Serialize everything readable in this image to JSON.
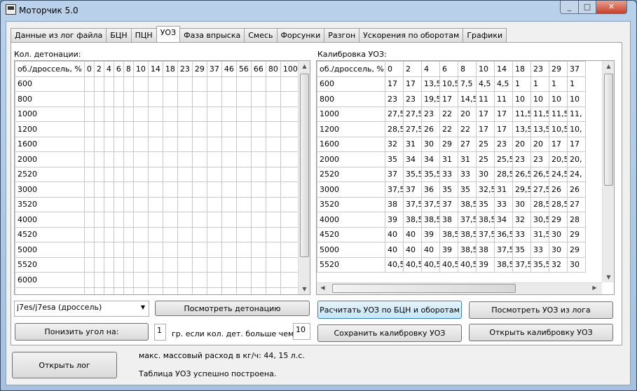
{
  "window": {
    "title": "Моторчик 5.0"
  },
  "tabs": [
    "Данные из лог файла",
    "БЦН",
    "ПЦН",
    "УОЗ",
    "Фаза впрыска",
    "Смесь",
    "Форсунки",
    "Разгон",
    "Ускорения по оборотам",
    "Графики"
  ],
  "active_tab": "УОЗ",
  "left": {
    "label": "Кол. детонации:",
    "corner": "об./дроссель, %",
    "columns": [
      "0",
      "2",
      "4",
      "6",
      "8",
      "10",
      "14",
      "18",
      "23",
      "29",
      "37",
      "46",
      "56",
      "66",
      "80",
      "100"
    ],
    "rows": [
      "600",
      "800",
      "1000",
      "1200",
      "1600",
      "2000",
      "2520",
      "3000",
      "3520",
      "4000",
      "4520",
      "5000",
      "5520",
      "6000"
    ]
  },
  "right": {
    "label": "Калибровка УОЗ:",
    "corner": "об./дроссель, %",
    "columns": [
      "0",
      "2",
      "4",
      "6",
      "8",
      "10",
      "14",
      "18",
      "23",
      "29",
      "37"
    ],
    "rows": [
      {
        "rpm": "600",
        "v": [
          "17",
          "17",
          "13,5",
          "10,5",
          "7,5",
          "4,5",
          "4,5",
          "1",
          "1",
          "1",
          "1"
        ]
      },
      {
        "rpm": "800",
        "v": [
          "23",
          "23",
          "19,5",
          "17",
          "14,5",
          "11",
          "11",
          "10",
          "10",
          "10",
          "10"
        ]
      },
      {
        "rpm": "1000",
        "v": [
          "27,5",
          "27,5",
          "23",
          "22",
          "20",
          "17",
          "17",
          "11,5",
          "11,5",
          "11,5",
          "11,"
        ]
      },
      {
        "rpm": "1200",
        "v": [
          "28,5",
          "27,5",
          "26",
          "22",
          "22",
          "17",
          "17",
          "13,5",
          "13,5",
          "10,5",
          "10,"
        ]
      },
      {
        "rpm": "1600",
        "v": [
          "32",
          "31",
          "30",
          "29",
          "27",
          "25",
          "23",
          "20",
          "20",
          "17",
          "17"
        ]
      },
      {
        "rpm": "2000",
        "v": [
          "35",
          "34",
          "34",
          "31",
          "31",
          "25",
          "25,5",
          "23",
          "23",
          "20,5",
          "20,"
        ]
      },
      {
        "rpm": "2520",
        "v": [
          "37",
          "35,5",
          "35,5",
          "33",
          "33",
          "30",
          "28,5",
          "26,5",
          "26,5",
          "24,5",
          "24,"
        ]
      },
      {
        "rpm": "3000",
        "v": [
          "37,5",
          "37",
          "36",
          "35",
          "35",
          "32,5",
          "31",
          "29,5",
          "27,5",
          "26",
          "26"
        ]
      },
      {
        "rpm": "3520",
        "v": [
          "38",
          "37,5",
          "37,5",
          "37",
          "38,5",
          "35",
          "33",
          "30",
          "28,5",
          "28,5",
          "27"
        ]
      },
      {
        "rpm": "4000",
        "v": [
          "39",
          "38,5",
          "38,5",
          "38",
          "37,5",
          "38,5",
          "34",
          "32",
          "30,5",
          "29",
          "28"
        ]
      },
      {
        "rpm": "4520",
        "v": [
          "40",
          "40",
          "39",
          "38,5",
          "38,5",
          "37,5",
          "36,5",
          "33",
          "31,5",
          "30",
          "29"
        ]
      },
      {
        "rpm": "5000",
        "v": [
          "40",
          "40",
          "40",
          "39",
          "38,5",
          "38",
          "37,5",
          "35",
          "33",
          "30",
          "29"
        ]
      },
      {
        "rpm": "5520",
        "v": [
          "40,5",
          "40,5",
          "40,5",
          "40,5",
          "40,5",
          "39",
          "38,5",
          "37,5",
          "35,5",
          "32",
          "30"
        ]
      }
    ]
  },
  "controls": {
    "engine_select": "j7es/j7esa (дроссель)",
    "view_detonation": "Посмотреть детонацию",
    "lower_angle": "Понизить угол на:",
    "angle_value": "1",
    "threshold_text": "гр. если кол. дет. больше чем:",
    "threshold_value": "10",
    "calc_uoz": "Расчитать УОЗ по БЦН и оборотам",
    "view_uoz_log": "Посмотреть УОЗ из лога",
    "save_calib": "Сохранить калибровку УОЗ",
    "open_calib": "Открыть калибровку УОЗ",
    "open_log": "Открыть лог"
  },
  "status": {
    "mass_flow": "макс. массовый расход в кг/ч: 44, 15 л.с.",
    "message": "Таблица УОЗ успешно построена."
  }
}
